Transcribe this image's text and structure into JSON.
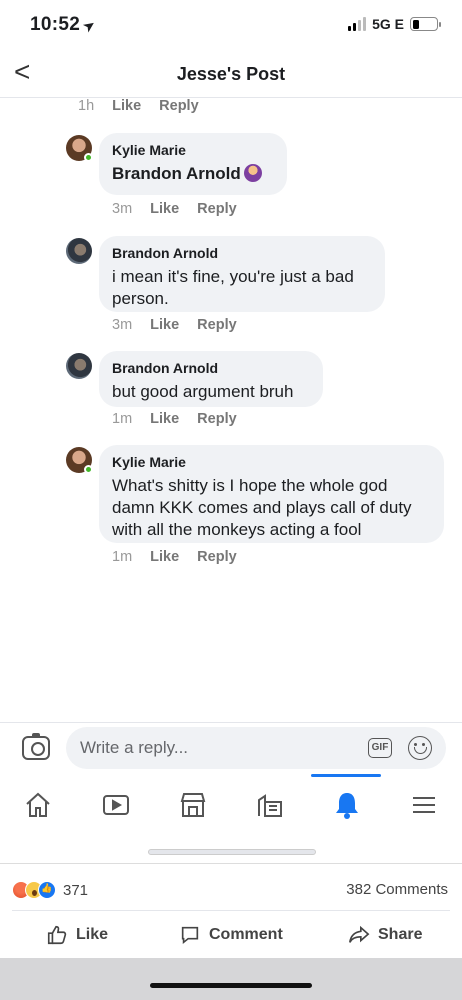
{
  "status_bar": {
    "time": "10:52",
    "network": "5G E"
  },
  "header": {
    "back_label": "<",
    "title": "Jesse's Post"
  },
  "top_meta": {
    "time": "1h",
    "like": "Like",
    "reply": "Reply"
  },
  "comments": [
    {
      "author": "Kylie Marie",
      "text": "Brandon Arnold",
      "time": "3m",
      "like": "Like",
      "reply": "Reply"
    },
    {
      "author": "Brandon Arnold",
      "text": "i mean it's fine, you're just a bad person.",
      "time": "3m",
      "like": "Like",
      "reply": "Reply"
    },
    {
      "author": "Brandon Arnold",
      "text": "but good argument bruh",
      "time": "1m",
      "like": "Like",
      "reply": "Reply"
    },
    {
      "author": "Kylie Marie",
      "text": "What's shitty is I hope the whole god damn KKK comes and plays call of duty with all the monkeys acting a fool",
      "time": "1m",
      "like": "Like",
      "reply": "Reply"
    }
  ],
  "reply_bar": {
    "placeholder": "Write a reply...",
    "gif_label": "GIF"
  },
  "tab_bar": {
    "tabs": [
      "home-icon",
      "video-icon",
      "marketplace-icon",
      "pages-icon",
      "notifications-icon",
      "menu-icon"
    ],
    "active": "notifications-icon",
    "accent": "#1877f2"
  },
  "post_footer": {
    "reaction_icons": [
      "angry-icon",
      "wow-icon",
      "like-icon"
    ],
    "reaction_count": "371",
    "comment_count": "382 Comments",
    "like_label": "Like",
    "comment_label": "Comment",
    "share_label": "Share"
  }
}
